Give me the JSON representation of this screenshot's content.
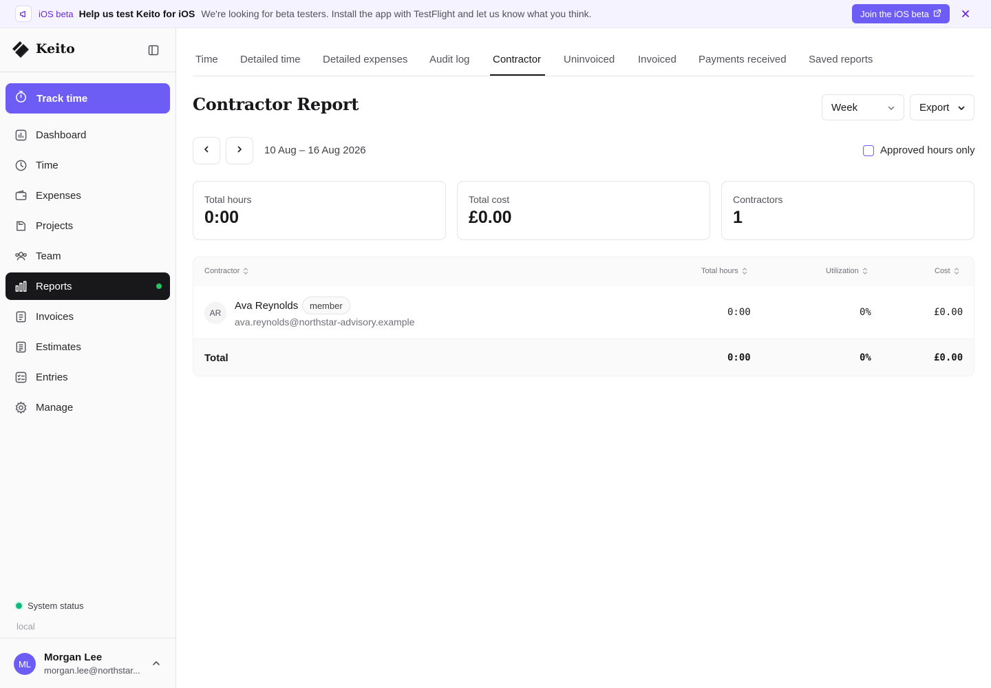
{
  "banner": {
    "icon": "megaphone-icon",
    "tag": "iOS beta",
    "title": "Help us test Keito for iOS",
    "text": "We're looking for beta testers. Install the app with TestFlight and let us know what you think.",
    "button_label": "Join the iOS beta",
    "accent": "#6d5df5"
  },
  "app": {
    "name": "Keito"
  },
  "sidebar": {
    "track_label": "Track time",
    "items": [
      {
        "label": "Dashboard",
        "icon": "dashboard-icon"
      },
      {
        "label": "Time",
        "icon": "clock-icon"
      },
      {
        "label": "Expenses",
        "icon": "wallet-icon"
      },
      {
        "label": "Projects",
        "icon": "folder-icon"
      },
      {
        "label": "Team",
        "icon": "users-icon"
      },
      {
        "label": "Reports",
        "icon": "bar-chart-icon",
        "active": true
      },
      {
        "label": "Invoices",
        "icon": "invoice-icon"
      },
      {
        "label": "Estimates",
        "icon": "estimate-icon"
      },
      {
        "label": "Entries",
        "icon": "checklist-icon"
      },
      {
        "label": "Manage",
        "icon": "gear-icon"
      }
    ],
    "system_status": "System status",
    "environment": "local",
    "user": {
      "initials": "ML",
      "name": "Morgan Lee",
      "email": "morgan.lee@northstar..."
    }
  },
  "tabs": [
    "Time",
    "Detailed time",
    "Detailed expenses",
    "Audit log",
    "Contractor",
    "Uninvoiced",
    "Invoiced",
    "Payments received",
    "Saved reports"
  ],
  "active_tab": "Contractor",
  "page": {
    "title": "Contractor Report",
    "period_select": "Week",
    "export_label": "Export",
    "date_range": "10 Aug – 16 Aug 2026",
    "approved_only_label": "Approved hours only",
    "approved_only_checked": false
  },
  "stats": [
    {
      "label": "Total hours",
      "value": "0:00"
    },
    {
      "label": "Total cost",
      "value": "£0.00"
    },
    {
      "label": "Contractors",
      "value": "1"
    }
  ],
  "table": {
    "columns": [
      "Contractor",
      "Total hours",
      "Utilization",
      "Cost"
    ],
    "rows": [
      {
        "initials": "AR",
        "name": "Ava Reynolds",
        "role": "member",
        "email": "ava.reynolds@northstar-advisory.example",
        "total_hours": "0:00",
        "utilization": "0%",
        "cost": "£0.00"
      }
    ],
    "total": {
      "label": "Total",
      "total_hours": "0:00",
      "utilization": "0%",
      "cost": "£0.00"
    }
  }
}
